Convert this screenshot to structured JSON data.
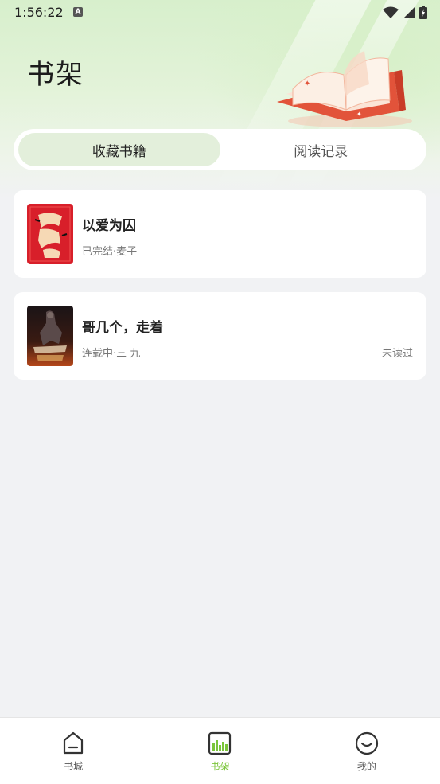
{
  "status_bar": {
    "time": "1:56:22",
    "notification_icon": "a-icon",
    "icons": [
      "wifi-icon",
      "signal-icon",
      "battery-icon"
    ]
  },
  "header": {
    "title": "书架"
  },
  "tabs": [
    {
      "label": "收藏书籍",
      "active": true
    },
    {
      "label": "阅读记录",
      "active": false
    }
  ],
  "books": [
    {
      "title": "以爱为囚",
      "meta": "已完结·麦子",
      "status": "",
      "cover_color": "#d81f2a"
    },
    {
      "title": "哥几个，走着",
      "meta": "连载中·三 九",
      "status": "未读过",
      "cover_color": "#2a1c1c"
    }
  ],
  "bottom_nav": [
    {
      "label": "书城",
      "icon": "home-icon",
      "active": false
    },
    {
      "label": "书架",
      "icon": "bookshelf-icon",
      "active": true
    },
    {
      "label": "我的",
      "icon": "profile-icon",
      "active": false
    }
  ],
  "colors": {
    "accent": "#7bc53a",
    "tab_active_bg": "#e3efdb"
  }
}
